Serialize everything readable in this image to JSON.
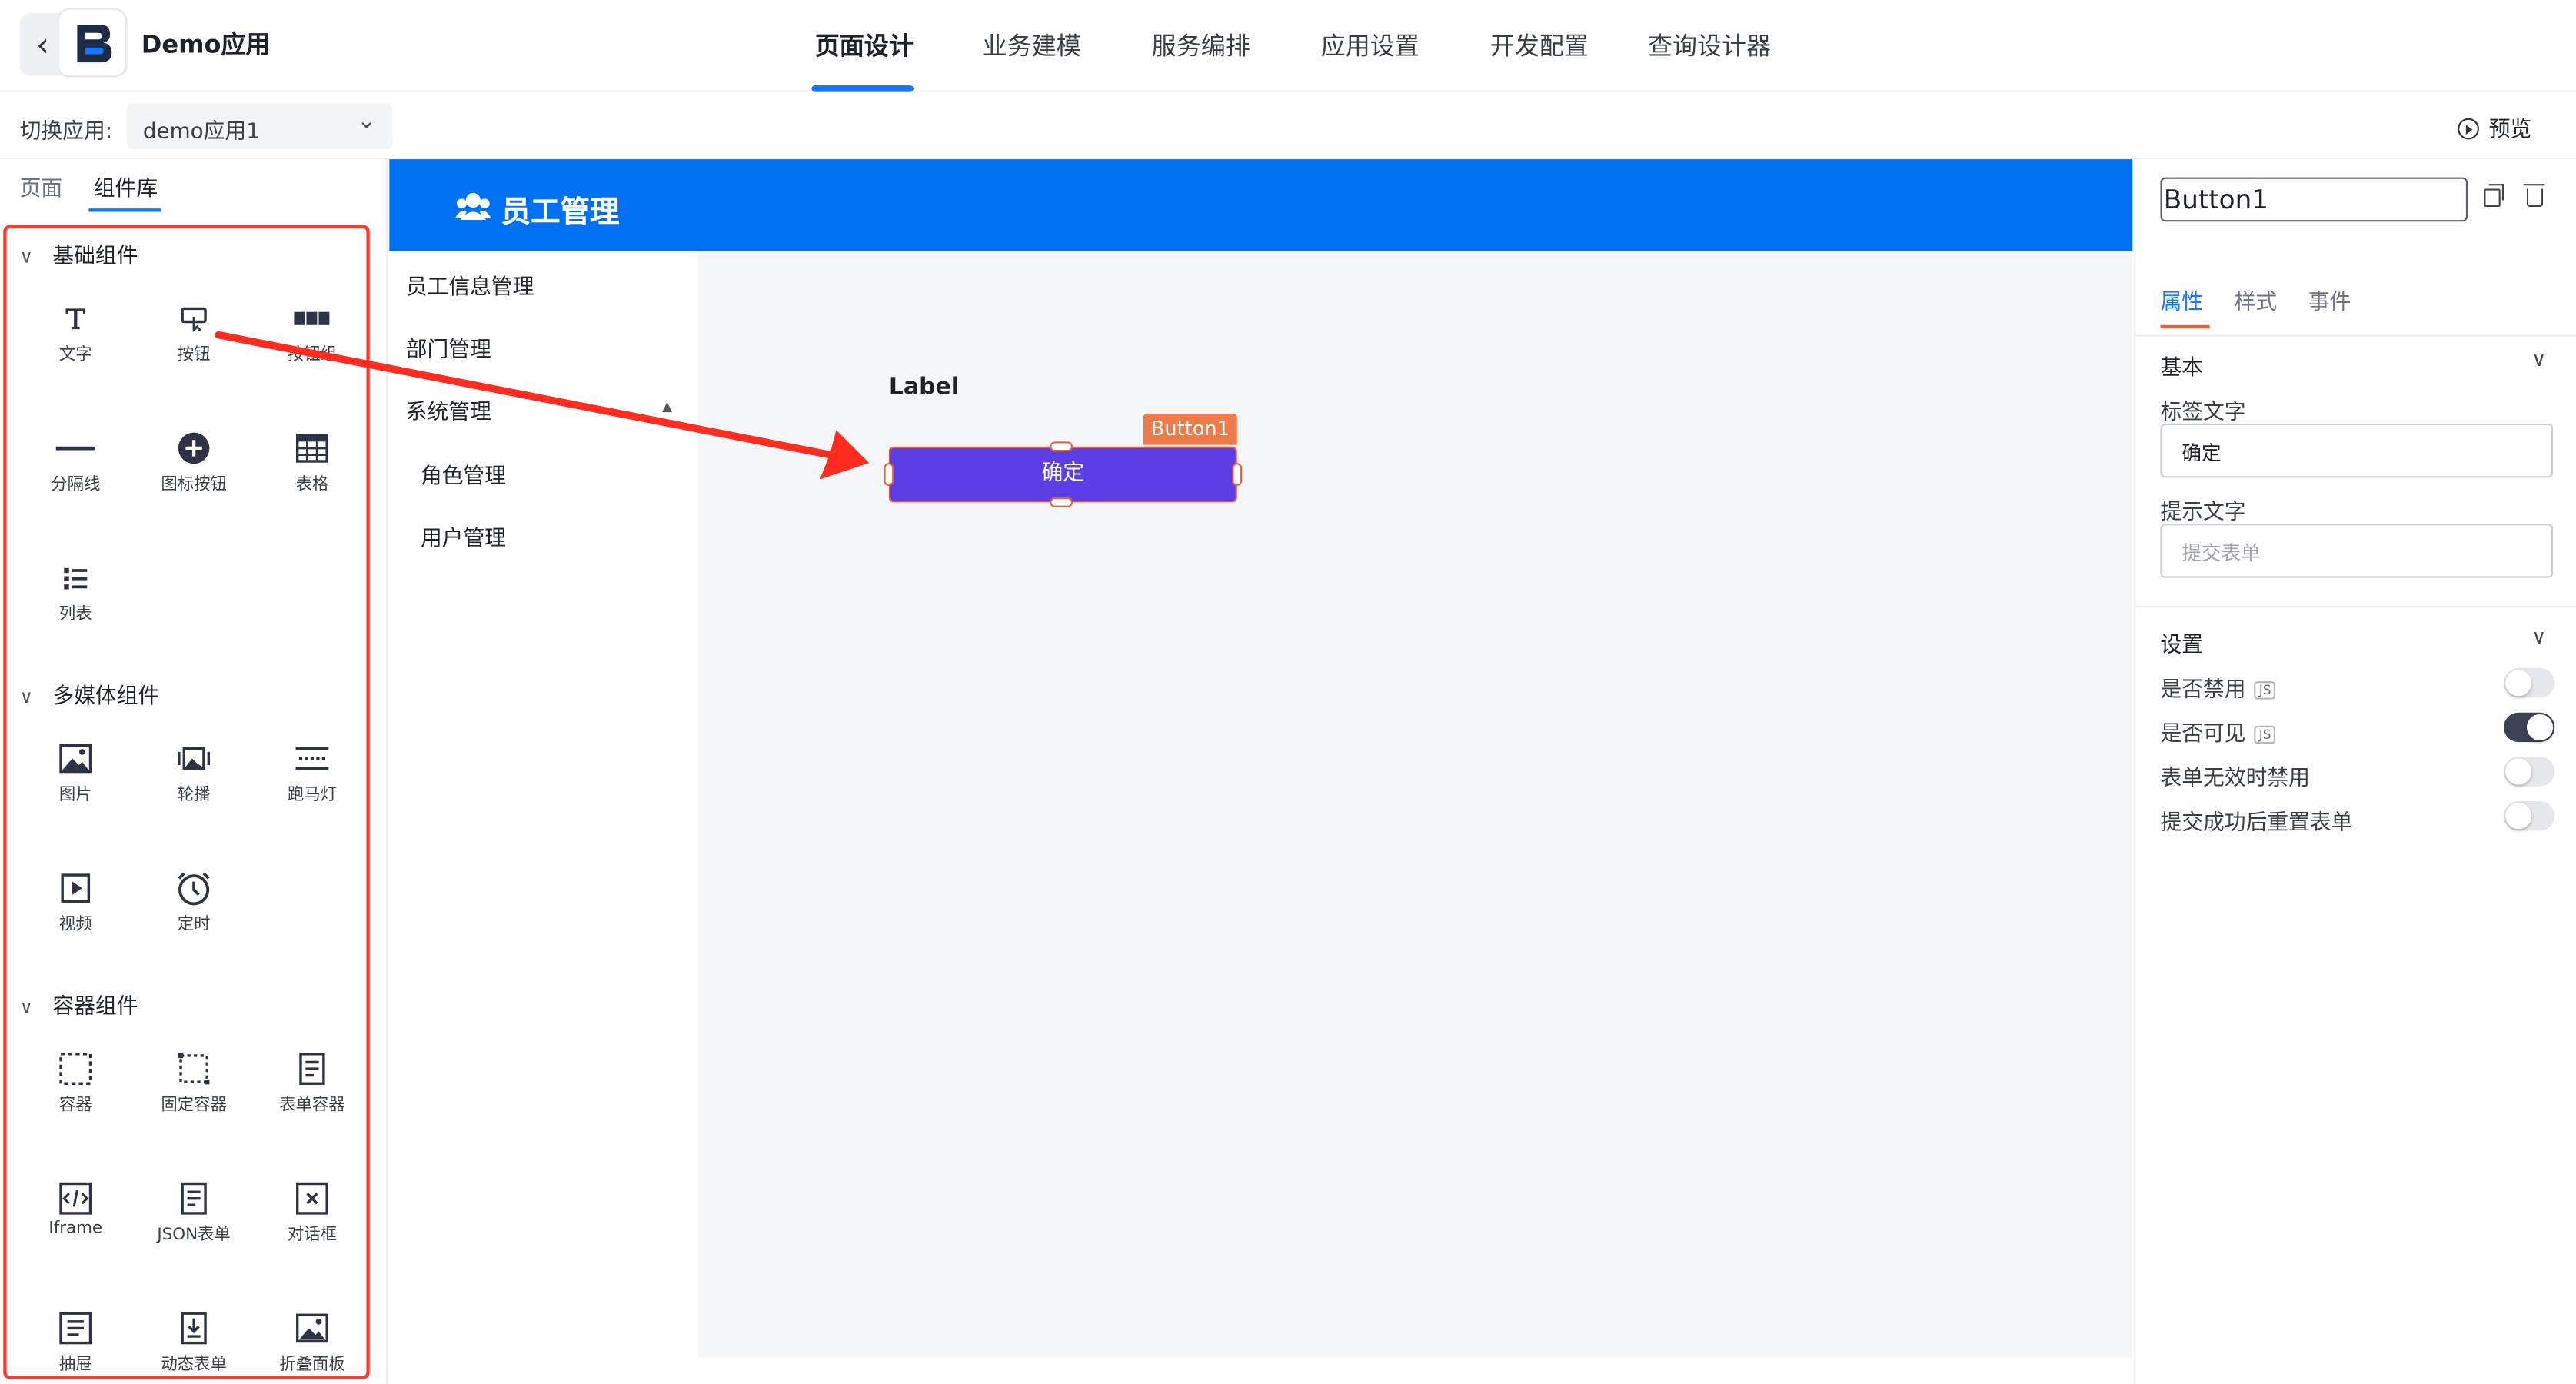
{
  "app": {
    "title": "Demo应用"
  },
  "nav": {
    "tabs": [
      {
        "label": "页面设计",
        "active": true
      },
      {
        "label": "业务建模"
      },
      {
        "label": "服务编排"
      },
      {
        "label": "应用设置"
      },
      {
        "label": "开发配置"
      },
      {
        "label": "查询设计器"
      }
    ]
  },
  "subbar": {
    "switch_label": "切换应用:",
    "app_value": "demo应用1",
    "preview_label": "预览"
  },
  "left": {
    "tabs": [
      {
        "label": "页面"
      },
      {
        "label": "组件库",
        "active": true
      }
    ],
    "sections": [
      {
        "title": "基础组件",
        "items": [
          {
            "label": "文字",
            "icon": "text-icon"
          },
          {
            "label": "按钮",
            "icon": "button-icon"
          },
          {
            "label": "按钮组",
            "icon": "button-group-icon"
          },
          {
            "label": "分隔线",
            "icon": "divider-icon"
          },
          {
            "label": "图标按钮",
            "icon": "icon-button-icon"
          },
          {
            "label": "表格",
            "icon": "table-icon"
          },
          {
            "label": "列表",
            "icon": "list-icon"
          }
        ]
      },
      {
        "title": "多媒体组件",
        "items": [
          {
            "label": "图片",
            "icon": "image-icon"
          },
          {
            "label": "轮播",
            "icon": "carousel-icon"
          },
          {
            "label": "跑马灯",
            "icon": "marquee-icon"
          },
          {
            "label": "视频",
            "icon": "video-icon"
          },
          {
            "label": "定时",
            "icon": "timer-icon"
          }
        ]
      },
      {
        "title": "容器组件",
        "items": [
          {
            "label": "容器",
            "icon": "container-icon"
          },
          {
            "label": "固定容器",
            "icon": "fixed-container-icon"
          },
          {
            "label": "表单容器",
            "icon": "form-container-icon"
          },
          {
            "label": "Iframe",
            "icon": "iframe-icon"
          },
          {
            "label": "JSON表单",
            "icon": "json-form-icon"
          },
          {
            "label": "对话框",
            "icon": "dialog-icon"
          },
          {
            "label": "抽屉",
            "icon": "drawer-icon"
          },
          {
            "label": "动态表单",
            "icon": "dynamic-form-icon"
          },
          {
            "label": "折叠面板",
            "icon": "collapse-icon"
          }
        ]
      }
    ]
  },
  "canvas": {
    "header_title": "员工管理",
    "menu": [
      {
        "label": "员工信息管理"
      },
      {
        "label": "部门管理"
      },
      {
        "label": "系统管理"
      },
      {
        "label": "角色管理"
      },
      {
        "label": "用户管理"
      }
    ],
    "label_text": "Label",
    "selected_tag": "Button1",
    "button_text": "确定"
  },
  "right": {
    "component_name": "Button1",
    "tabs": [
      {
        "label": "属性",
        "active": true
      },
      {
        "label": "样式"
      },
      {
        "label": "事件"
      }
    ],
    "basic_title": "基本",
    "label_field": {
      "label": "标签文字",
      "value": "确定"
    },
    "hint_field": {
      "label": "提示文字",
      "placeholder": "提交表单"
    },
    "settings_title": "设置",
    "settings": [
      {
        "label": "是否禁用",
        "js": "JS",
        "on": false
      },
      {
        "label": "是否可见",
        "js": "JS",
        "on": true
      },
      {
        "label": "表单无效时禁用",
        "on": false
      },
      {
        "label": "提交成功后重置表单",
        "on": false
      }
    ]
  },
  "colors": {
    "accent": "#1677ff",
    "header_blue": "#0070f3",
    "button_purple": "#5c3fe4",
    "selection_orange": "#ee7b4a",
    "annotation_red": "#ff3b30"
  }
}
